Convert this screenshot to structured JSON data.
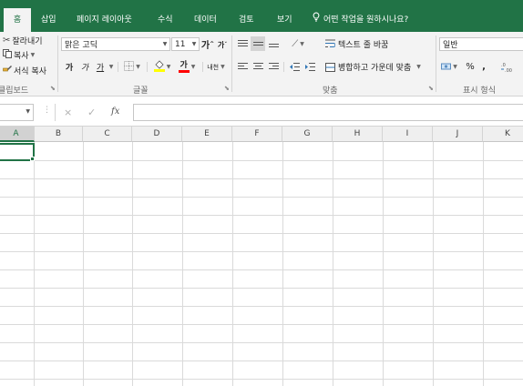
{
  "tabs": [
    {
      "label": "홈",
      "active": true
    },
    {
      "label": "삽입"
    },
    {
      "label": "페이지 레이아웃"
    },
    {
      "label": "수식"
    },
    {
      "label": "데이터"
    },
    {
      "label": "검토"
    },
    {
      "label": "보기"
    }
  ],
  "tell_me": "어떤 작업을 원하시나요?",
  "clipboard": {
    "cut": "잘라내기",
    "copy": "복사",
    "format_painter": "서식 복사",
    "group_label": "클립보드"
  },
  "font": {
    "name": "맑은 고딕",
    "size": "11",
    "bold": "가",
    "italic": "가",
    "underline": "가",
    "grow": "가",
    "shrink": "가",
    "phonetic": "내천",
    "group_label": "글꼴",
    "fill_color": "#ffff00",
    "font_color": "#ff0000"
  },
  "alignment": {
    "wrap_text": "텍스트 줄 바꿈",
    "merge_center": "병합하고 가운데 맞춤",
    "group_label": "맞춤"
  },
  "number": {
    "format": "일반",
    "percent": "%",
    "comma": ",",
    "group_label": "표시 형식"
  },
  "formula_bar": {
    "cancel": "×",
    "enter": "✓",
    "fx": "fx",
    "value": ""
  },
  "columns": [
    "A",
    "B",
    "C",
    "D",
    "E",
    "F",
    "G",
    "H",
    "I",
    "J",
    "K"
  ],
  "selected_column": "A",
  "colors": {
    "accent": "#217346",
    "ribbon_bg": "#f3f3f3"
  }
}
